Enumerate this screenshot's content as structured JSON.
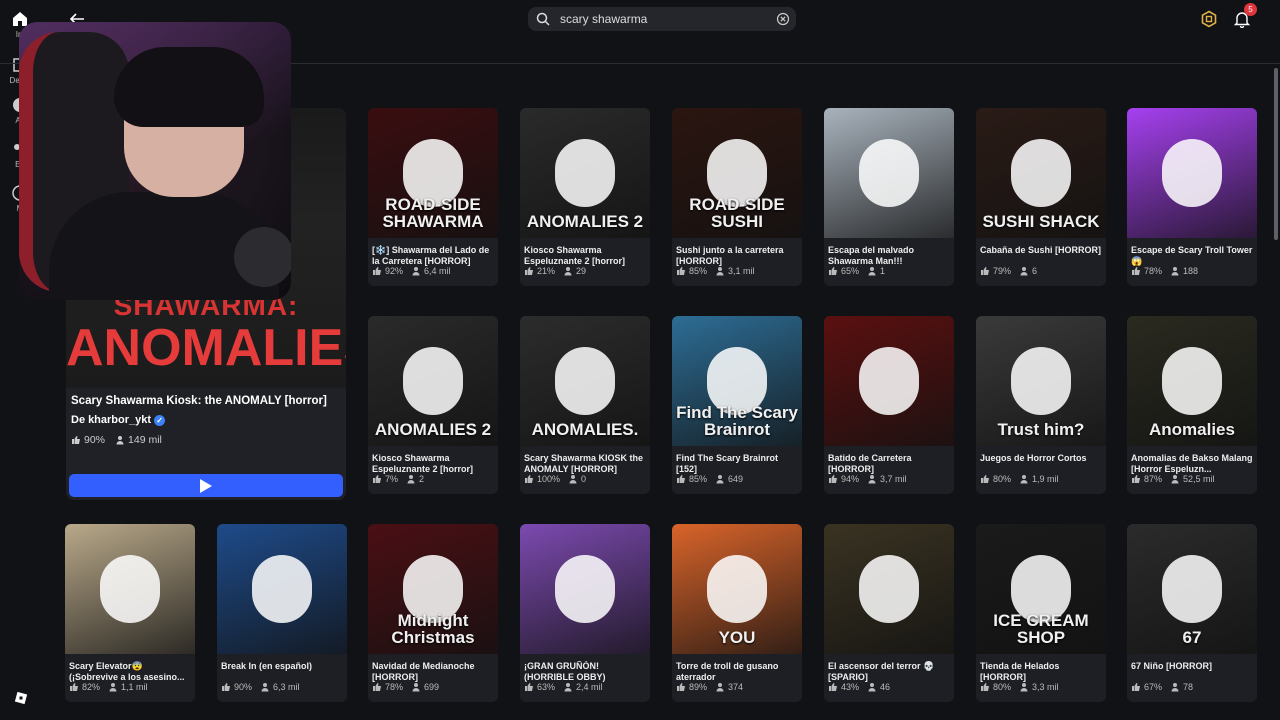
{
  "search": {
    "value": "scary shawarma"
  },
  "notifications": {
    "count": "5"
  },
  "nav": [
    {
      "label": "Ini",
      "icon": "home-icon"
    },
    {
      "label": "Desta",
      "icon": "chart-icon"
    },
    {
      "label": "Av",
      "icon": "avatar-icon"
    },
    {
      "label": "Eq",
      "icon": "team-icon"
    },
    {
      "label": "M",
      "icon": "more-icon"
    }
  ],
  "featured": {
    "thumb_line1": "SHAWARMA:",
    "thumb_line2": "ANOMALIES",
    "title": "Scary Shawarma Kiosk: the ANOMALY [horror]",
    "creator_prefix": "De",
    "creator": "kharbor_ykt",
    "rating": "90%",
    "players": "149 mil"
  },
  "games": [
    {
      "name": "[❄️] Shawarma del Lado de la Carretera [HORROR]",
      "rating": "92%",
      "players": "6,4 mil",
      "caption": "ROAD-SIDE SHAWARMA",
      "color": "#3a0d10"
    },
    {
      "name": "Kiosco Shawarma Espeluznante 2 [horror]",
      "rating": "21%",
      "players": "29",
      "caption": "ANOMALIES 2",
      "color": "#2a2a2a"
    },
    {
      "name": "Sushi junto a la carretera [HORROR]",
      "rating": "85%",
      "players": "3,1 mil",
      "caption": "ROAD-SIDE SUSHI",
      "color": "#2b1510"
    },
    {
      "name": "Escapa del malvado Shawarma Man!!!",
      "rating": "65%",
      "players": "1",
      "caption": "",
      "color": "#a9b3bd"
    },
    {
      "name": "Cabaña de Sushi [HORROR]",
      "rating": "79%",
      "players": "6",
      "caption": "SUSHI SHACK",
      "color": "#2a1b16"
    },
    {
      "name": "Escape de Scary Troll Tower 😱",
      "rating": "78%",
      "players": "188",
      "caption": "",
      "color": "#a640f0"
    },
    {
      "name": "Kiosco Shawarma Espeluznante 2 [horror]",
      "rating": "7%",
      "players": "2",
      "caption": "ANOMALIES 2",
      "color": "#2a2a2a"
    },
    {
      "name": "Scary Shawarma KIOSK the ANOMALY [HORROR]",
      "rating": "100%",
      "players": "0",
      "caption": "ANOMALIES.",
      "color": "#2c2c2c"
    },
    {
      "name": "Find The Scary Brainrot [152]",
      "rating": "85%",
      "players": "649",
      "caption": "Find The Scary Brainrot",
      "color": "#2d6d95"
    },
    {
      "name": "Batido de Carretera [HORROR]",
      "rating": "94%",
      "players": "3,7 mil",
      "caption": "",
      "color": "#5b1010"
    },
    {
      "name": "Juegos de Horror Cortos",
      "rating": "80%",
      "players": "1,9 mil",
      "caption": "Trust him?",
      "color": "#3a3a3a"
    },
    {
      "name": "Anomalias de Bakso Malang [Horror Espeluzn...",
      "rating": "87%",
      "players": "52,5 mil",
      "caption": "Anomalies",
      "color": "#2a2a20"
    },
    {
      "name": "Scary Elevator😨 (¡Sobrevive a los asesino...",
      "rating": "82%",
      "players": "1,1 mil",
      "caption": "",
      "color": "#b9a98a"
    },
    {
      "name": "Break In (en español)",
      "rating": "90%",
      "players": "6,3 mil",
      "caption": "",
      "color": "#1e4b8a"
    },
    {
      "name": "Navidad de Medianoche [HORROR]",
      "rating": "78%",
      "players": "699",
      "caption": "Midnight Christmas",
      "color": "#4a0f14"
    },
    {
      "name": "¡GRAN GRUÑÓN! (HORRIBLE OBBY)",
      "rating": "63%",
      "players": "2,4 mil",
      "caption": "",
      "color": "#7c4ab0"
    },
    {
      "name": "Torre de troll de gusano aterrador",
      "rating": "89%",
      "players": "374",
      "caption": "YOU",
      "color": "#d9642a"
    },
    {
      "name": "El ascensor del terror 💀 [SPARIO]",
      "rating": "43%",
      "players": "46",
      "caption": "",
      "color": "#3a3322"
    },
    {
      "name": "Tienda de Helados [HORROR]",
      "rating": "80%",
      "players": "3,3 mil",
      "caption": "ICE CREAM SHOP",
      "color": "#1a1a1a"
    },
    {
      "name": "67 Niño [HORROR]",
      "rating": "67%",
      "players": "78",
      "caption": "67",
      "color": "#2b2b2b"
    }
  ]
}
